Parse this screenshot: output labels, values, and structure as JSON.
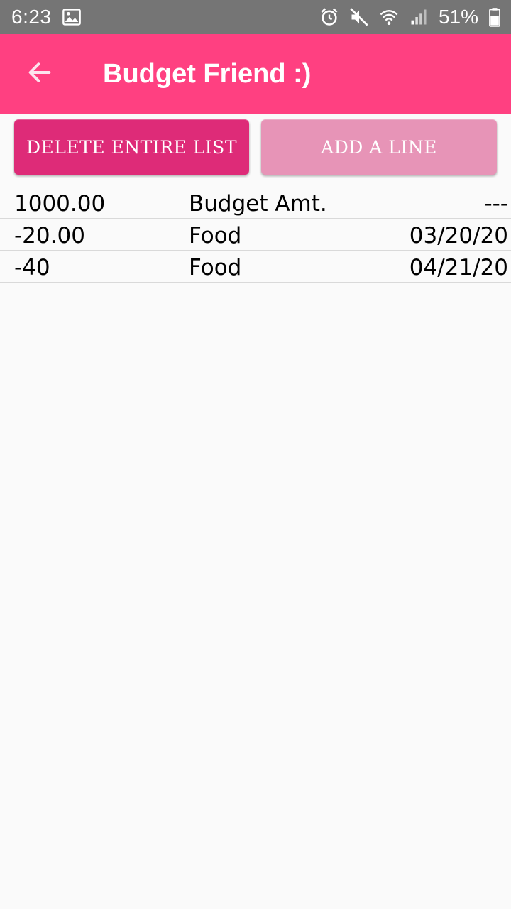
{
  "status_bar": {
    "time": "6:23",
    "battery": "51%",
    "icons": [
      "image-icon",
      "alarm-icon",
      "mute-icon",
      "wifi-icon",
      "signal-icon",
      "battery-icon"
    ]
  },
  "app_bar": {
    "title": "Budget Friend :)",
    "back_icon": "arrow-back-icon"
  },
  "actions": {
    "delete_label": "DELETE ENTIRE LIST",
    "add_label": "ADD A LINE"
  },
  "colors": {
    "status_bar": "#757575",
    "app_bar": "#ff4081",
    "delete_button": "#de2b78",
    "add_button": "#e794b7",
    "background": "#fafafa"
  },
  "rows": [
    {
      "amount": "1000.00",
      "category": "Budget Amt.",
      "date": "---"
    },
    {
      "amount": "-20.00",
      "category": "Food",
      "date": "03/20/20"
    },
    {
      "amount": "-40",
      "category": "Food",
      "date": "04/21/20"
    }
  ]
}
